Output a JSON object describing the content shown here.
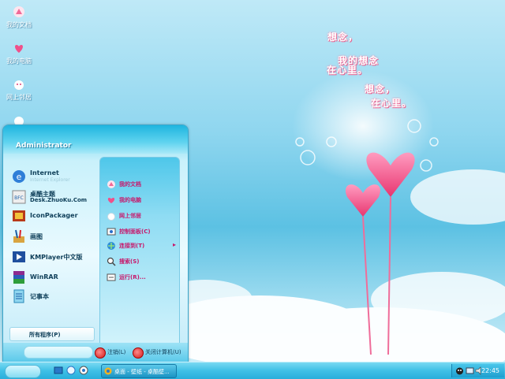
{
  "desktop": {
    "icons": [
      {
        "label": "我的文档",
        "icon": "documents-icon"
      },
      {
        "label": "我的电脑",
        "icon": "computer-icon"
      },
      {
        "label": "网上邻居",
        "icon": "network-icon"
      }
    ],
    "wallpaper_text": [
      "想念，",
      "我的想念",
      "在心里。",
      "想念，",
      "在心里。"
    ],
    "colors": {
      "sky": "#5cc1e3",
      "heart": "#f0508a"
    }
  },
  "start_menu": {
    "user": "Administrator",
    "left_items": [
      {
        "line1": "Internet",
        "line2": "",
        "sub": "Internet Explorer",
        "icon": "internet-explorer-icon"
      },
      {
        "line1": "桌酷主题",
        "line2": "Desk.ZhuoKu.Com",
        "sub": "",
        "icon": "theme-icon"
      },
      {
        "line1": "IconPackager",
        "line2": "",
        "sub": "",
        "icon": "iconpackager-icon"
      },
      {
        "line1": "画图",
        "line2": "",
        "sub": "",
        "icon": "paint-icon"
      },
      {
        "line1": "KMPlayer中文版",
        "line2": "",
        "sub": "",
        "icon": "kmplayer-icon"
      },
      {
        "line1": "WinRAR",
        "line2": "",
        "sub": "",
        "icon": "winrar-icon"
      },
      {
        "line1": "记事本",
        "line2": "",
        "sub": "",
        "icon": "notepad-icon"
      }
    ],
    "all_programs": "所有程序(P)",
    "right_items": [
      {
        "label": "我的文档",
        "icon": "documents-icon"
      },
      {
        "label": "我的电脑",
        "icon": "computer-icon"
      },
      {
        "label": "网上邻居",
        "icon": "network-icon"
      },
      {
        "label": "控制面板(C)",
        "icon": "control-panel-icon"
      },
      {
        "label": "连接到(T)",
        "icon": "connect-icon",
        "arrow": "▸"
      },
      {
        "label": "搜索(S)",
        "icon": "search-icon"
      },
      {
        "label": "运行(R)...",
        "icon": "run-icon"
      }
    ],
    "logoff": "注销(L)",
    "shutdown": "关闭计算机(U)"
  },
  "taskbar": {
    "task_title": "桌面 - 壁纸 - 桌酷壁...",
    "clock": "22:45"
  }
}
